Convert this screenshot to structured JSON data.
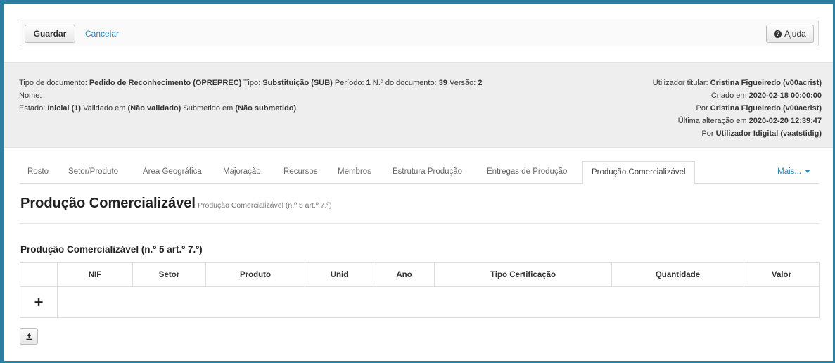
{
  "toolbar": {
    "save_label": "Guardar",
    "cancel_label": "Cancelar",
    "help_label": "Ajuda"
  },
  "info": {
    "doc_type_label": "Tipo de documento:",
    "doc_type_value": "Pedido de Reconhecimento (OPREPREC)",
    "type_label": "Tipo:",
    "type_value": "Substituição (SUB)",
    "period_label": "Período:",
    "period_value": "1",
    "doc_num_label": "N.º do documento:",
    "doc_num_value": "39",
    "version_label": "Versão:",
    "version_value": "2",
    "name_label": "Nome:",
    "name_value": "",
    "state_label": "Estado:",
    "state_value": "Inicial (1)",
    "validated_label": "Validado em",
    "validated_value": "(Não validado)",
    "submitted_label": "Submetido em",
    "submitted_value": "(Não submetido)",
    "owner_label": "Utilizador titular:",
    "owner_value": "Cristina Figueiredo (v00acrist)",
    "created_label": "Criado em",
    "created_value": "2020-02-18 00:00:00",
    "created_by_label": "Por",
    "created_by_value": "Cristina Figueiredo (v00acrist)",
    "modified_label": "Última alteração em",
    "modified_value": "2020-02-20 12:39:47",
    "modified_by_label": "Por",
    "modified_by_value": "Utilizador Idigital (vaatstidig)"
  },
  "tabs": [
    {
      "label": "Rosto"
    },
    {
      "label": "Setor/Produto"
    },
    {
      "label": "Área Geográfica"
    },
    {
      "label": "Majoração"
    },
    {
      "label": "Recursos"
    },
    {
      "label": "Membros"
    },
    {
      "label": "Estrutura Produção"
    },
    {
      "label": "Entregas de Produção"
    },
    {
      "label": "Produção Comercializável",
      "active": true
    }
  ],
  "more_label": "Mais...",
  "page": {
    "title": "Produção Comercializável",
    "subtitle": "Produção Comercializável (n.º 5 art.º 7.º)",
    "section_title": "Produção Comercializável (n.º 5 art.º 7.º)"
  },
  "table": {
    "columns": [
      "NIF",
      "Setor",
      "Produto",
      "Unid",
      "Ano",
      "Tipo Certificação",
      "Quantidade",
      "Valor"
    ],
    "add_symbol": "+"
  },
  "icons": {
    "help": "question-circle-icon",
    "upload": "upload-icon",
    "more": "caret-down-icon"
  },
  "colors": {
    "frame": "#2b7fa3",
    "link": "#2a88bd",
    "panel": "#eeeeee"
  }
}
